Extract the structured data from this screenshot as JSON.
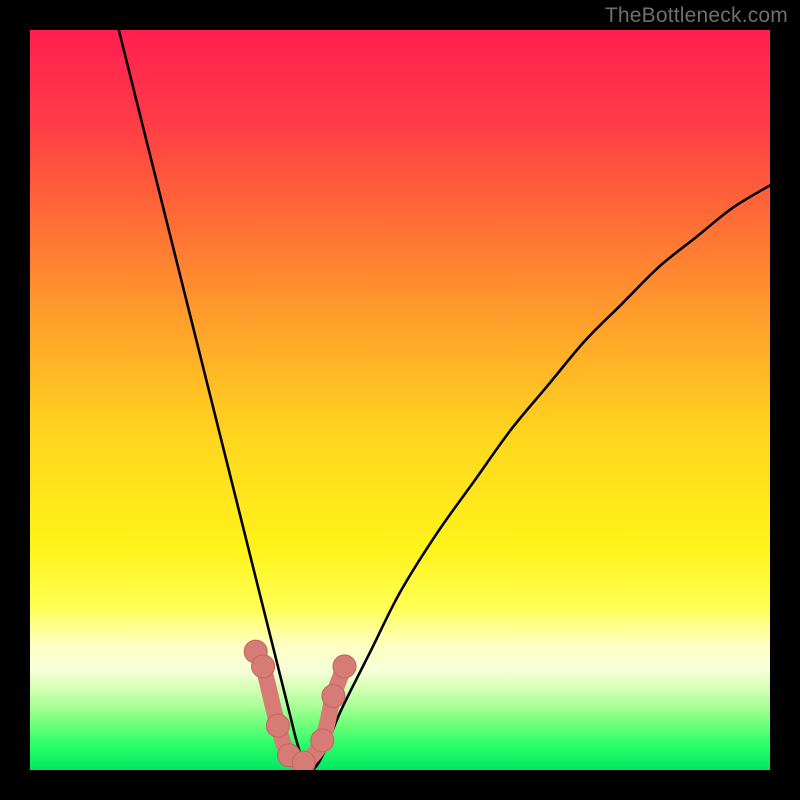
{
  "watermark": "TheBottleneck.com",
  "colors": {
    "frame": "#000000",
    "curve_stroke": "#000000",
    "marker_fill": "#d77b77",
    "marker_stroke": "#c76560",
    "gradient_stops": [
      {
        "offset": 0.0,
        "color": "#ff1f50"
      },
      {
        "offset": 0.12,
        "color": "#ff3a47"
      },
      {
        "offset": 0.25,
        "color": "#ff6a36"
      },
      {
        "offset": 0.4,
        "color": "#ffa22a"
      },
      {
        "offset": 0.55,
        "color": "#ffd61e"
      },
      {
        "offset": 0.7,
        "color": "#fff31a"
      },
      {
        "offset": 0.78,
        "color": "#ffff55"
      },
      {
        "offset": 0.83,
        "color": "#ffffc0"
      },
      {
        "offset": 0.865,
        "color": "#f6ffd8"
      },
      {
        "offset": 0.89,
        "color": "#d4ffb4"
      },
      {
        "offset": 0.915,
        "color": "#a6ff95"
      },
      {
        "offset": 0.94,
        "color": "#6aff7a"
      },
      {
        "offset": 0.965,
        "color": "#2dff68"
      },
      {
        "offset": 1.0,
        "color": "#00e763"
      }
    ]
  },
  "chart_data": {
    "type": "line",
    "title": "",
    "xlabel": "",
    "ylabel": "",
    "xlim": [
      0,
      100
    ],
    "ylim": [
      0,
      100
    ],
    "grid": false,
    "series": [
      {
        "name": "bottleneck-curve",
        "x": [
          12,
          14,
          16,
          18,
          20,
          22,
          24,
          26,
          28,
          30,
          32,
          33,
          34,
          35,
          36,
          37,
          38,
          39,
          40,
          42,
          46,
          50,
          55,
          60,
          65,
          70,
          75,
          80,
          85,
          90,
          95,
          100
        ],
        "y": [
          100,
          92,
          84,
          76,
          68,
          60,
          52,
          44,
          36,
          28,
          20,
          16,
          12,
          8,
          4,
          1,
          0,
          1,
          3,
          8,
          16,
          24,
          32,
          39,
          46,
          52,
          58,
          63,
          68,
          72,
          76,
          79
        ]
      }
    ],
    "markers": {
      "name": "highlight-points",
      "x": [
        30.5,
        31.5,
        33.5,
        35.0,
        37.0,
        39.5,
        41.0,
        42.5
      ],
      "y": [
        16.0,
        14.0,
        6.0,
        2.0,
        1.0,
        4.0,
        10.0,
        14.0
      ]
    }
  }
}
